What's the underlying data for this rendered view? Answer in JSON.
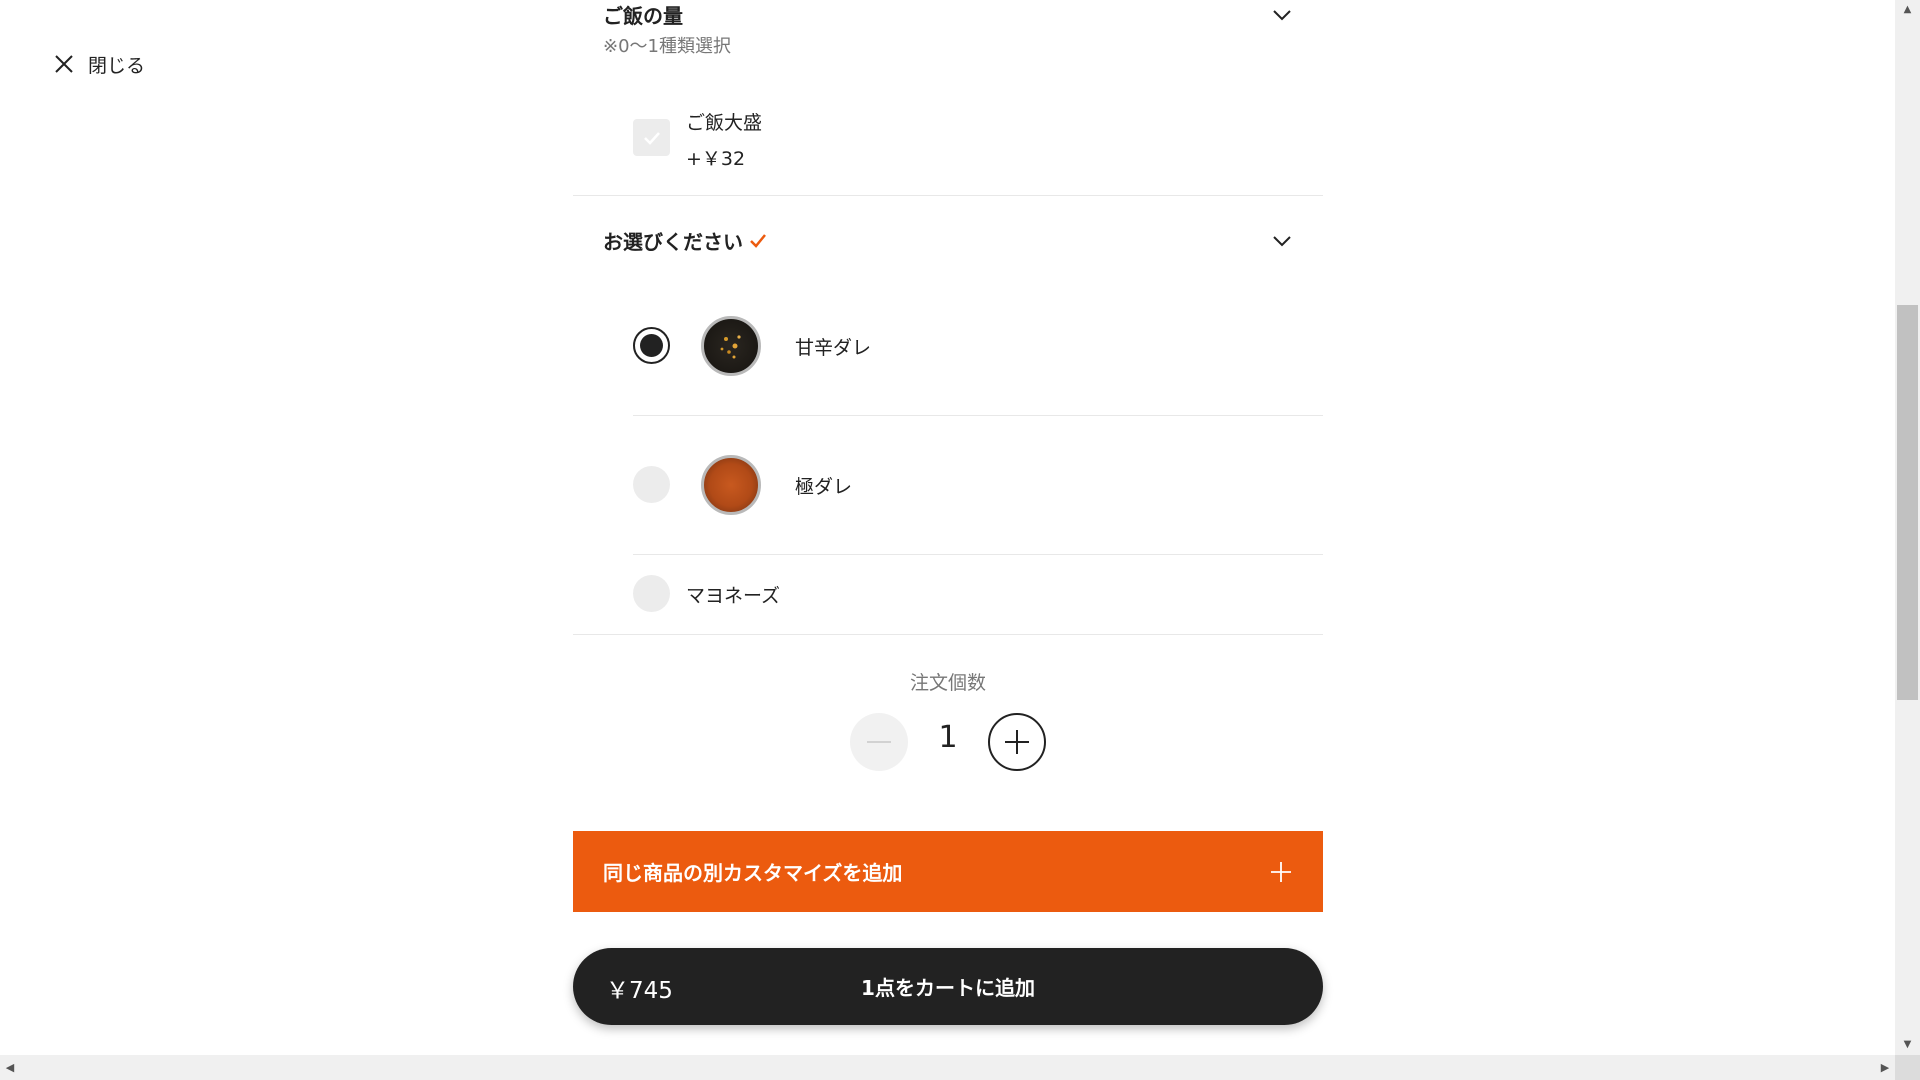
{
  "header": {
    "close_label": "閉じる"
  },
  "rice_section": {
    "title": "ご飯の量",
    "subtitle": "※0〜1種類選択",
    "option_label": "ご飯大盛",
    "option_price": "+￥32"
  },
  "sauce_section": {
    "title": "お選びください",
    "check_color": "#ec5b0f",
    "options": [
      {
        "label": "甘辛ダレ",
        "selected": true,
        "icon": "sweet-spicy-sauce-image"
      },
      {
        "label": "極ダレ",
        "selected": false,
        "icon": "kiwami-sauce-image"
      },
      {
        "label": "マヨネーズ",
        "selected": false
      }
    ]
  },
  "quantity": {
    "label": "注文個数",
    "value": "1"
  },
  "custom_button": {
    "label": "同じ商品の別カスタマイズを追加"
  },
  "cart_button": {
    "price": "￥745",
    "label": "1点をカートに追加"
  },
  "colors": {
    "accent": "#ec5b0f",
    "dark": "#222222"
  }
}
